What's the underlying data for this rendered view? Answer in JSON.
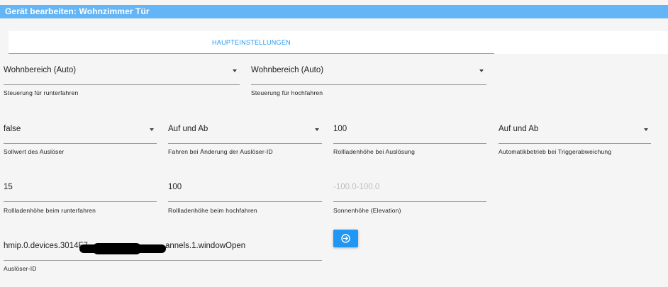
{
  "dialog": {
    "title": "Gerät bearbeiten: Wohnzimmer Tür"
  },
  "tabs": [
    {
      "label": "HAUPTEINSTELLUNGEN"
    }
  ],
  "fields": {
    "down_control": {
      "value": "Wohnbereich (Auto)",
      "label": "Steuerung für runterfahren"
    },
    "up_control": {
      "value": "Wohnbereich (Auto)",
      "label": "Steuerung für hochfahren"
    },
    "trigger_setpoint": {
      "value": "false",
      "label": "Sollwert des Auslöser"
    },
    "trigger_change": {
      "value": "Auf und Ab",
      "label": "Fahren bei Änderung der Auslöser-ID"
    },
    "trigger_height": {
      "value": "100",
      "label": "Rollladenhöhe bei Auslösung"
    },
    "auto_mode": {
      "value": "Auf und Ab",
      "label": "Automatikbetrieb bei Triggerabweichung"
    },
    "down_height": {
      "value": "15",
      "label": "Rollladenhöhe beim runterfahren"
    },
    "up_height": {
      "value": "100",
      "label": "Rollladenhöhe beim hochfahren"
    },
    "elevation": {
      "placeholder": "-100.0-100.0",
      "label": "Sonnenhöhe (Elevation)"
    },
    "trigger_id": {
      "value_start": "hmip.0.devices.3014F7",
      "value_end": "annels.1.windowOpen",
      "label": "Auslöser-ID"
    }
  },
  "icons": {
    "select_button": "arrow-circle-right-icon"
  },
  "colors": {
    "header": "#64b5f6",
    "accent": "#2196f3"
  }
}
